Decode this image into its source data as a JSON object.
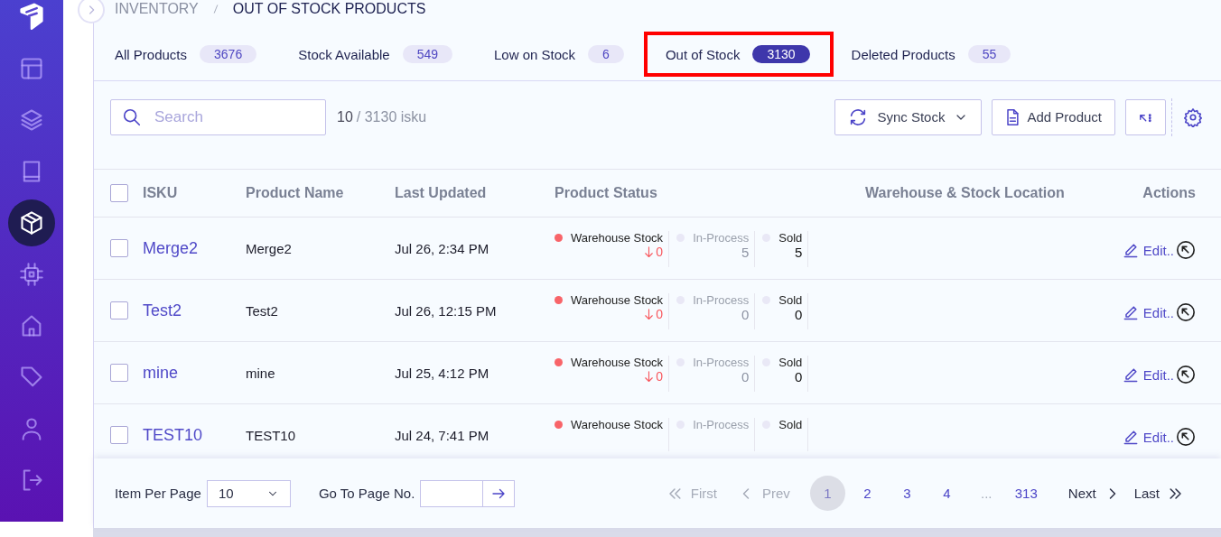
{
  "sidebar": {
    "items": [
      {
        "kind": "layout",
        "selected": false
      },
      {
        "kind": "layers",
        "selected": false
      },
      {
        "kind": "book",
        "selected": false
      },
      {
        "kind": "box",
        "selected": true
      },
      {
        "kind": "chip",
        "selected": false
      },
      {
        "kind": "home",
        "selected": false
      },
      {
        "kind": "tag",
        "selected": false
      },
      {
        "kind": "user",
        "selected": false
      },
      {
        "kind": "logout",
        "selected": false
      }
    ]
  },
  "breadcrumb": [
    "INVENTORY",
    "OUT OF STOCK PRODUCTS"
  ],
  "tabs": [
    {
      "label": "All Products",
      "count": "3676",
      "selected": false,
      "highlighted": false
    },
    {
      "label": "Stock Available",
      "count": "549",
      "selected": false,
      "highlighted": false
    },
    {
      "label": "Low on Stock",
      "count": "6",
      "selected": false,
      "highlighted": false
    },
    {
      "label": "Out of Stock",
      "count": "3130",
      "selected": true,
      "highlighted": true
    },
    {
      "label": "Deleted Products",
      "count": "55",
      "selected": false,
      "highlighted": false
    }
  ],
  "toolbar": {
    "search": {
      "placeholder": "Search"
    },
    "count_shown": "10",
    "count_total": "/ 3130 isku",
    "buttons": [
      {
        "kind": "sync",
        "label": "Sync Stock"
      },
      {
        "kind": "add",
        "label": "Add Product"
      },
      {
        "kind": "expand"
      }
    ]
  },
  "table": {
    "header_checkbox": {
      "checked": false
    },
    "columns": [
      "ISKU",
      "Product Name",
      "Last Updated",
      "Product Status",
      "Warehouse & Stock Location",
      "Actions"
    ],
    "rows": [
      {
        "checked": false,
        "isku": "Merge2",
        "name": "Merge2",
        "updated": "Jul 26, 2:34 PM",
        "status": [
          {
            "kind": "warehouse",
            "label": "Warehouse Stock",
            "value": "0",
            "color": "#f86469"
          },
          {
            "kind": "plain",
            "label": "In-Process",
            "value": "5",
            "color": "#e9e8f6"
          },
          {
            "kind": "strong",
            "label": "Sold",
            "value": "5",
            "color": "#e9e8f6"
          }
        ],
        "action": "Edit.."
      },
      {
        "checked": false,
        "isku": "Test2",
        "name": "Test2",
        "updated": "Jul 26, 12:15 PM",
        "status": [
          {
            "kind": "warehouse",
            "label": "Warehouse Stock",
            "value": "0",
            "color": "#f86469"
          },
          {
            "kind": "plain",
            "label": "In-Process",
            "value": "0",
            "color": "#e9e8f6"
          },
          {
            "kind": "strong",
            "label": "Sold",
            "value": "0",
            "color": "#e9e8f6"
          }
        ],
        "action": "Edit.."
      },
      {
        "checked": false,
        "isku": "mine",
        "name": "mine",
        "updated": "Jul 25, 4:12 PM",
        "status": [
          {
            "kind": "warehouse",
            "label": "Warehouse Stock",
            "value": "0",
            "color": "#f86469"
          },
          {
            "kind": "plain",
            "label": "In-Process",
            "value": "0",
            "color": "#e9e8f6"
          },
          {
            "kind": "strong",
            "label": "Sold",
            "value": "0",
            "color": "#e9e8f6"
          }
        ],
        "action": "Edit.."
      },
      {
        "checked": false,
        "isku": "TEST10",
        "name": "TEST10",
        "updated": "Jul 24, 7:41 PM",
        "status": [
          {
            "kind": "warehouse",
            "label": "Warehouse Stock",
            "color": "#f86469"
          },
          {
            "kind": "plain",
            "label": "In-Process",
            "color": "#e9e8f6"
          },
          {
            "kind": "strong",
            "label": "Sold",
            "color": "#e9e8f6"
          }
        ],
        "action": "Edit.."
      }
    ]
  },
  "footer": {
    "per_page_label": "Item Per Page",
    "per_page_value": "10",
    "goto_label": "Go To Page No.",
    "first": {
      "label": "First",
      "disabled": true
    },
    "prev": {
      "label": "Prev",
      "disabled": true
    },
    "pages": [
      {
        "kind": "page",
        "label": "1",
        "selected": true
      },
      {
        "kind": "page",
        "label": "2",
        "selected": false
      },
      {
        "kind": "page",
        "label": "3",
        "selected": false
      },
      {
        "kind": "page",
        "label": "4",
        "selected": false
      },
      {
        "kind": "gap",
        "label": "...",
        "selected": false
      },
      {
        "kind": "page",
        "label": "313",
        "selected": false
      }
    ],
    "next": {
      "label": "Next",
      "disabled": false
    },
    "last": {
      "label": "Last",
      "disabled": false
    }
  }
}
